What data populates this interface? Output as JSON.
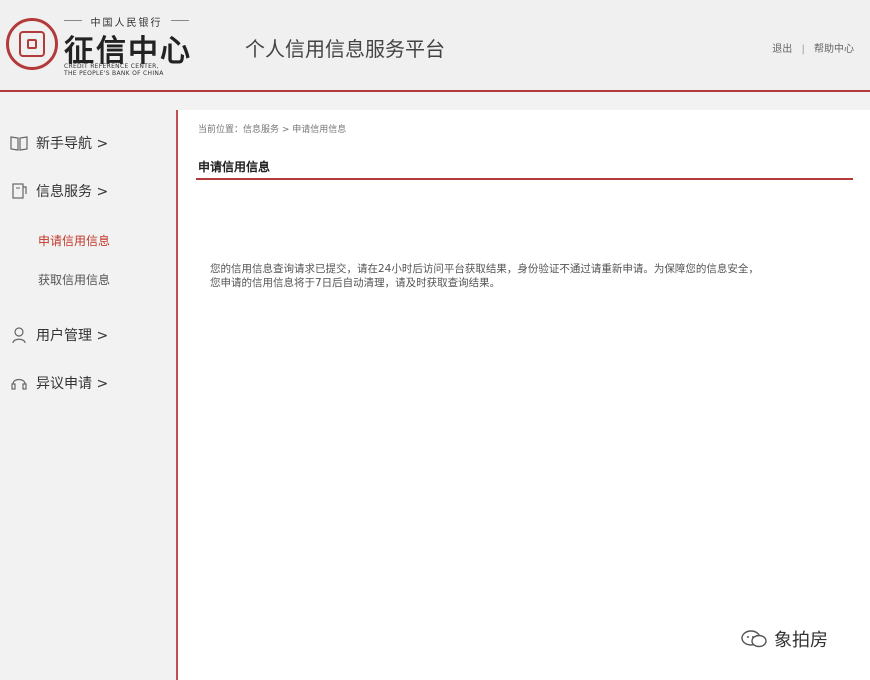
{
  "header": {
    "logo": {
      "top_text": "中国人民银行",
      "name_cn": "征信中心",
      "name_en_1": "CREDIT REFERENCE CENTER,",
      "name_en_2": "THE PEOPLE'S BANK OF CHINA"
    },
    "platform_title": "个人信用信息服务平台",
    "links": {
      "logout": "退出",
      "help": "帮助中心"
    }
  },
  "sidebar": {
    "items": [
      {
        "label": "新手导航 >",
        "icon": "book-icon"
      },
      {
        "label": "信息服务 >",
        "icon": "document-icon"
      },
      {
        "label": "用户管理 >",
        "icon": "user-icon"
      },
      {
        "label": "异议申请 >",
        "icon": "headset-icon"
      }
    ],
    "sub_items": [
      {
        "label": "申请信用信息",
        "active": true
      },
      {
        "label": "获取信用信息",
        "active": false
      }
    ]
  },
  "main": {
    "breadcrumb": "当前位置：信息服务 > 申请信用信息",
    "section_title": "申请信用信息",
    "message_line1": "您的信用信息查询请求已提交，请在24小时后访问平台获取结果，身份验证不通过请重新申请。为保障您的信息安全，",
    "message_line2": "您申请的信用信息将于7日后自动清理，请及时获取查询结果。"
  },
  "watermark": {
    "text": "象拍房"
  },
  "colors": {
    "accent": "#b33a3a",
    "active_link": "#c0392b"
  }
}
